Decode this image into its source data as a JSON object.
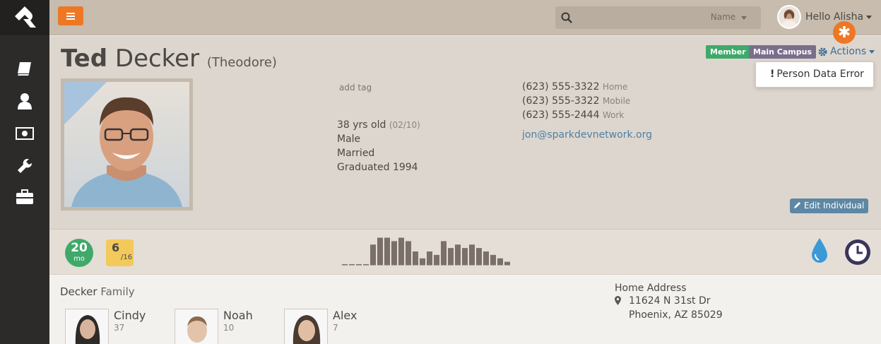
{
  "topbar": {
    "search_filter": "Name",
    "user_greeting": "Hello Alisha"
  },
  "person": {
    "first_name": "Ted",
    "last_name": "Decker",
    "nickname": "(Theodore)",
    "add_tag": "add tag",
    "age": "38 yrs old",
    "birthdate": "(02/10)",
    "gender": "Male",
    "marital_status": "Married",
    "graduation": "Graduated 1994",
    "phones": [
      {
        "number": "(623) 555-3322",
        "type": "Home"
      },
      {
        "number": "(623) 555-3322",
        "type": "Mobile"
      },
      {
        "number": "(623) 555-2444",
        "type": "Work"
      }
    ],
    "email": "jon@sparkdevnetwork.org",
    "badges": {
      "member": "Member",
      "campus": "Main Campus"
    },
    "actions_label": "Actions",
    "dropdown_item": "Person Data Error",
    "edit_label": "Edit Individual"
  },
  "stats": {
    "tenure_value": "20",
    "tenure_unit": "mo",
    "attendance_value": "6",
    "attendance_total": "/16",
    "attendance_bars": [
      0,
      0,
      0,
      0,
      6,
      8,
      8,
      7,
      8,
      7,
      4,
      2,
      4,
      3,
      7,
      5,
      6,
      5,
      6,
      5,
      4,
      3,
      2,
      1
    ]
  },
  "family": {
    "name": "Decker",
    "label": "Family",
    "members": [
      {
        "name": "Cindy",
        "age": "37"
      },
      {
        "name": "Noah",
        "age": "10"
      },
      {
        "name": "Alex",
        "age": "7"
      }
    ],
    "address_title": "Home Address",
    "address_line1": "11624 N 31st Dr",
    "address_line2": "Phoenix, AZ 85029"
  },
  "colors": {
    "accent": "#ee7725",
    "member_green": "#3fa96a",
    "campus_purple": "#7a6e8c",
    "link_blue": "#4f7fa3"
  }
}
